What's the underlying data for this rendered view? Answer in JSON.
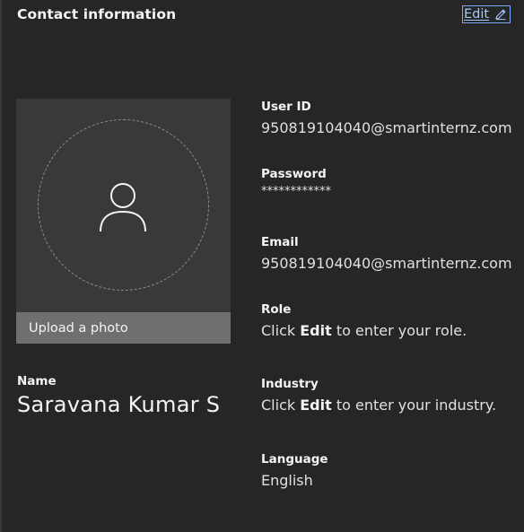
{
  "header": {
    "title": "Contact information",
    "edit_label": "Edit",
    "edit_icon": "pencil-icon",
    "accent_color": "#78a9ff"
  },
  "photo": {
    "avatar_icon": "user-avatar-icon",
    "upload_label": "Upload a photo"
  },
  "profile": {
    "name_label": "Name",
    "name_value": "Saravana Kumar S"
  },
  "fields": {
    "user_id": {
      "label": "User ID",
      "value": "950819104040@smartinternz.com"
    },
    "password": {
      "label": "Password",
      "value": "************"
    },
    "email": {
      "label": "Email",
      "value": "950819104040@smartinternz.com"
    },
    "role": {
      "label": "Role",
      "prefix": "Click ",
      "action": "Edit",
      "suffix": " to enter your role."
    },
    "industry": {
      "label": "Industry",
      "prefix": "Click ",
      "action": "Edit",
      "suffix": " to enter your industry."
    },
    "language": {
      "label": "Language",
      "value": "English"
    }
  }
}
